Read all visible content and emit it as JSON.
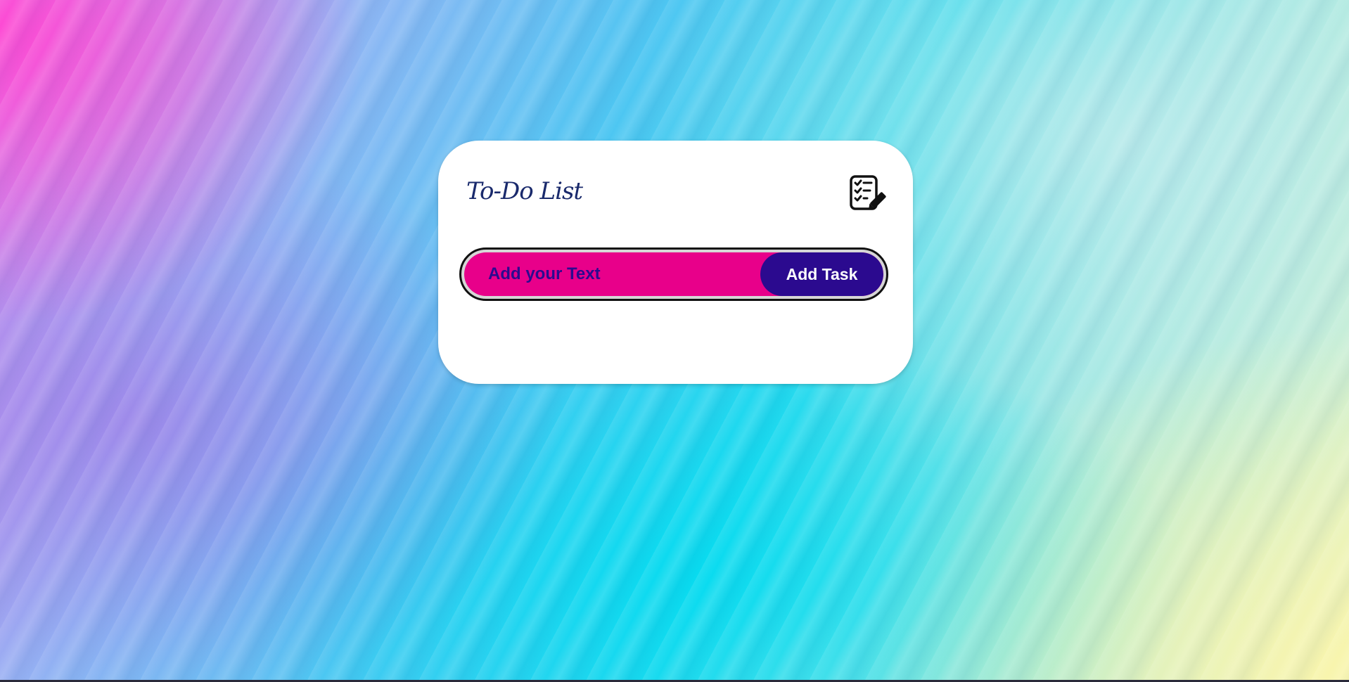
{
  "page": {
    "background": {
      "colors": [
        "#ff46d2",
        "#8fb6f4",
        "#28d8ee",
        "#9fe8e2",
        "#faf5aa"
      ]
    }
  },
  "card": {
    "title": "To-Do List",
    "icon": "checklist-edit-icon",
    "input": {
      "value": "",
      "placeholder": "Add your Text"
    },
    "add_button_label": "Add Task",
    "tasks": []
  },
  "colors": {
    "input_background": "#e8008a",
    "button_background": "#2b0a8f",
    "title_text": "#1a2a6c",
    "card_background": "#ffffff"
  }
}
